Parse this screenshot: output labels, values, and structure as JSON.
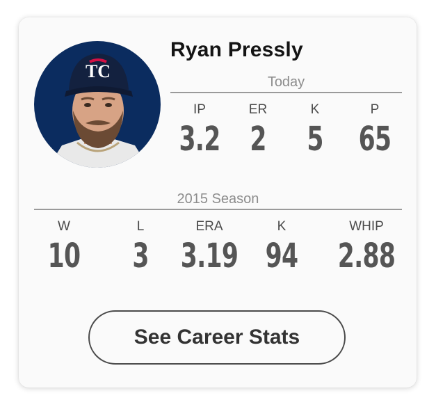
{
  "player": {
    "name": "Ryan Pressly"
  },
  "today": {
    "label": "Today",
    "stats": [
      {
        "label": "IP",
        "value": "3.2"
      },
      {
        "label": "ER",
        "value": "2"
      },
      {
        "label": "K",
        "value": "5"
      },
      {
        "label": "P",
        "value": "65"
      }
    ]
  },
  "season": {
    "label": "2015 Season",
    "stats": [
      {
        "label": "W",
        "value": "10"
      },
      {
        "label": "L",
        "value": "3"
      },
      {
        "label": "ERA",
        "value": "3.19"
      },
      {
        "label": "K",
        "value": "94"
      },
      {
        "label": "WHIP",
        "value": "2.88"
      }
    ]
  },
  "buttons": {
    "career": "See Career Stats"
  },
  "colors": {
    "avatar_bg": "#0b2c5f",
    "cap": "#13213f",
    "cap_logo_red": "#d31145"
  }
}
